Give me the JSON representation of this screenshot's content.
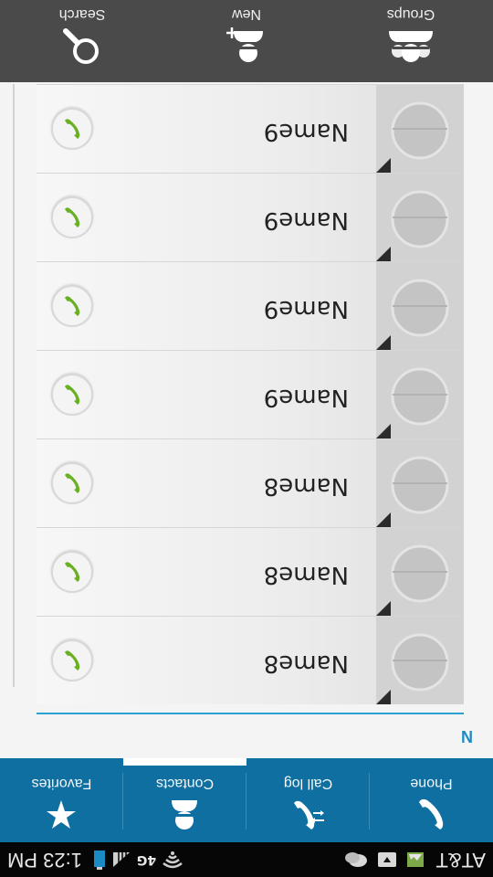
{
  "status_bar": {
    "carrier": "AT&T",
    "network": "4G",
    "time": "1:23 PM"
  },
  "tabs": [
    {
      "label": "Phone",
      "icon": "phone-icon",
      "selected": false
    },
    {
      "label": "Call log",
      "icon": "call-log-icon",
      "selected": false
    },
    {
      "label": "Contacts",
      "icon": "contacts-icon",
      "selected": true
    },
    {
      "label": "Favorites",
      "icon": "star-icon",
      "selected": false
    }
  ],
  "section": {
    "letter": "N"
  },
  "contacts": [
    {
      "name": "Name8"
    },
    {
      "name": "Name8"
    },
    {
      "name": "Name8"
    },
    {
      "name": "Name9"
    },
    {
      "name": "Name9"
    },
    {
      "name": "Name9"
    },
    {
      "name": "Name9"
    }
  ],
  "actions": [
    {
      "label": "Groups",
      "icon": "groups-icon"
    },
    {
      "label": "New",
      "icon": "add-contact-icon"
    },
    {
      "label": "Search",
      "icon": "search-icon"
    }
  ],
  "colors": {
    "accent": "#0e6fa0",
    "call_green": "#6ab023",
    "section_blue": "#1b8bc4"
  }
}
